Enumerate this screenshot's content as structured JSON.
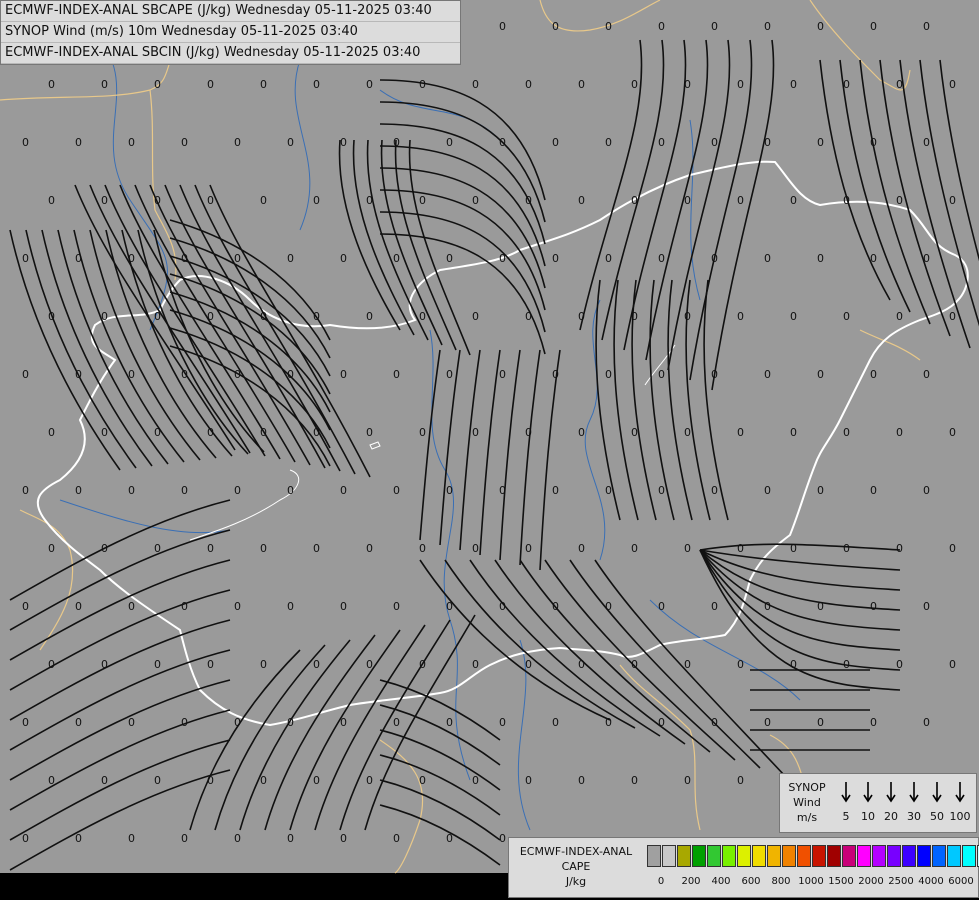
{
  "header": {
    "line1": "ECMWF-INDEX-ANAL SBCAPE (J/kg) Wednesday 05-11-2025 03:40",
    "line2": "SYNOP Wind (m/s) 10m Wednesday 05-11-2025 03:40",
    "line3": "ECMWF-INDEX-ANAL SBCIN (J/kg) Wednesday 05-11-2025 03:40"
  },
  "map": {
    "background_color": "#9a9a9a",
    "border_color": "#ffffff",
    "outer_border_color": "#e8c88a",
    "river_color": "#3a6fb5",
    "streamline_color": "#111111",
    "value_label": "0"
  },
  "synop_legend": {
    "title_line1": "SYNOP",
    "title_line2": "Wind",
    "title_line3": "m/s",
    "values": [
      "5",
      "10",
      "20",
      "30",
      "50",
      "100"
    ]
  },
  "cape_legend": {
    "title_line1": "ECMWF-INDEX-ANAL",
    "title_line2": "CAPE",
    "title_line3": "J/kg",
    "colors": [
      "#a0a0a0",
      "#c8c8c8",
      "#a8a800",
      "#00a000",
      "#32c832",
      "#78f000",
      "#dcf000",
      "#f0dc00",
      "#f0b400",
      "#f08200",
      "#f05000",
      "#c81400",
      "#a00000",
      "#c80078",
      "#ff00ff",
      "#b400ff",
      "#7800ff",
      "#3c00ff",
      "#0000ff",
      "#0064ff",
      "#00c8ff",
      "#00ffff",
      "#c8ffff"
    ],
    "ticks": [
      "0",
      "200",
      "400",
      "600",
      "800",
      "1000",
      "1500",
      "2000",
      "2500",
      "4000",
      "6000"
    ]
  }
}
